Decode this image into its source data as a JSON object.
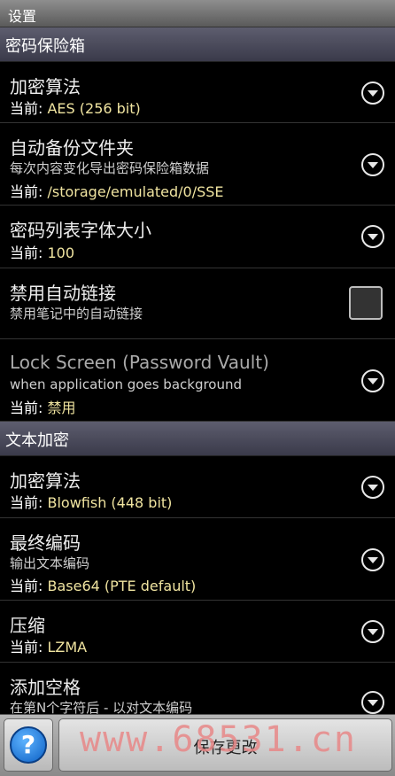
{
  "titlebar": {
    "title": "设置"
  },
  "sections": {
    "vault": {
      "label": "密码保险箱"
    },
    "text": {
      "label": "文本加密"
    }
  },
  "items": {
    "enc_algo": {
      "title": "加密算法",
      "cur_prefix": "当前: ",
      "value": "AES (256 bit)"
    },
    "backup_folder": {
      "title": "自动备份文件夹",
      "summary": "每次内容变化导出密码保险箱数据",
      "cur_prefix": "当前: ",
      "value": "/storage/emulated/0/SSE"
    },
    "font_size": {
      "title": "密码列表字体大小",
      "cur_prefix": "当前: ",
      "value": "100"
    },
    "disable_autolink": {
      "title": "禁用自动链接",
      "summary": "禁用笔记中的自动链接",
      "checked": false
    },
    "lock_screen": {
      "title": "Lock Screen (Password Vault)",
      "summary": "when application goes background",
      "cur_prefix": "当前: ",
      "value": "禁用"
    },
    "text_algo": {
      "title": "加密算法",
      "cur_prefix": "当前: ",
      "value": "Blowfish (448 bit)"
    },
    "final_encoding": {
      "title": "最终编码",
      "summary": "输出文本编码",
      "cur_prefix": "当前: ",
      "value": "Base64 (PTE default)"
    },
    "compression": {
      "title": "压缩",
      "cur_prefix": "当前: ",
      "value": "LZMA"
    },
    "add_spaces": {
      "title": "添加空格",
      "summary": "在第N个字符后 - 以对文本编码"
    }
  },
  "bottom": {
    "help_symbol": "?",
    "save_label": "保存更改"
  },
  "watermark": "www.68531.cn",
  "icons": {
    "dropdown": "chevron-down-circle-icon",
    "help": "help-icon",
    "checkbox": "checkbox-unchecked"
  }
}
